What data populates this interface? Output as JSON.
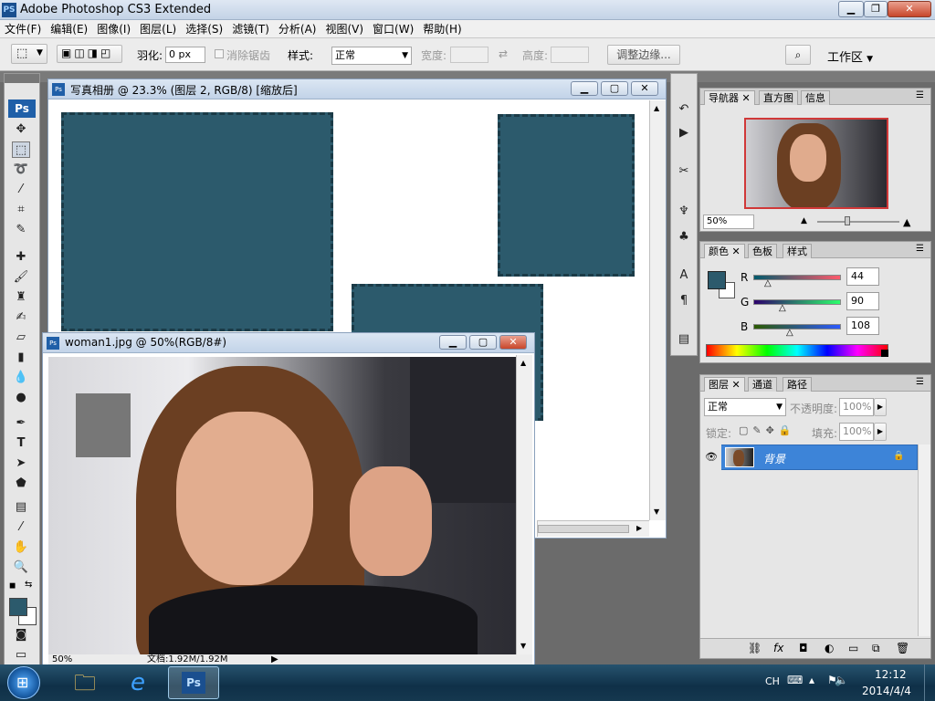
{
  "app": {
    "title": "Adobe Photoshop CS3 Extended",
    "icon": "PS"
  },
  "menu": [
    "文件(F)",
    "编辑(E)",
    "图像(I)",
    "图层(L)",
    "选择(S)",
    "滤镜(T)",
    "分析(A)",
    "视图(V)",
    "窗口(W)",
    "帮助(H)"
  ],
  "options": {
    "feather_label": "羽化:",
    "feather_value": "0 px",
    "antialias_label": "消除锯齿",
    "style_label": "样式:",
    "style_value": "正常",
    "width_label": "宽度:",
    "height_label": "高度:",
    "refine_edge": "调整边缘...",
    "workspace": "工作区"
  },
  "toolbox": {
    "logo": "Ps"
  },
  "doc1": {
    "title": "写真相册 @ 23.3% (图层 2, RGB/8) [缩放后]"
  },
  "doc2": {
    "title": "woman1.jpg @ 50%(RGB/8#)",
    "zoom": "50%",
    "docinfo": "文档:1.92M/1.92M"
  },
  "navigator": {
    "tabs": [
      "导航器",
      "直方图",
      "信息"
    ],
    "zoom": "50%"
  },
  "color": {
    "tabs": [
      "颜色",
      "色板",
      "样式"
    ],
    "r_label": "R",
    "g_label": "G",
    "b_label": "B",
    "r": "44",
    "g": "90",
    "b": "108",
    "fg": "#2c5a6c"
  },
  "layers": {
    "tabs": [
      "图层",
      "通道",
      "路径"
    ],
    "blend": "正常",
    "opacity_label": "不透明度:",
    "opacity": "100%",
    "lock_label": "锁定:",
    "fill_label": "填充:",
    "fill": "100%",
    "layer_name": "背景"
  },
  "taskbar": {
    "lang": "CH",
    "time": "12:12",
    "date": "2014/4/4"
  }
}
